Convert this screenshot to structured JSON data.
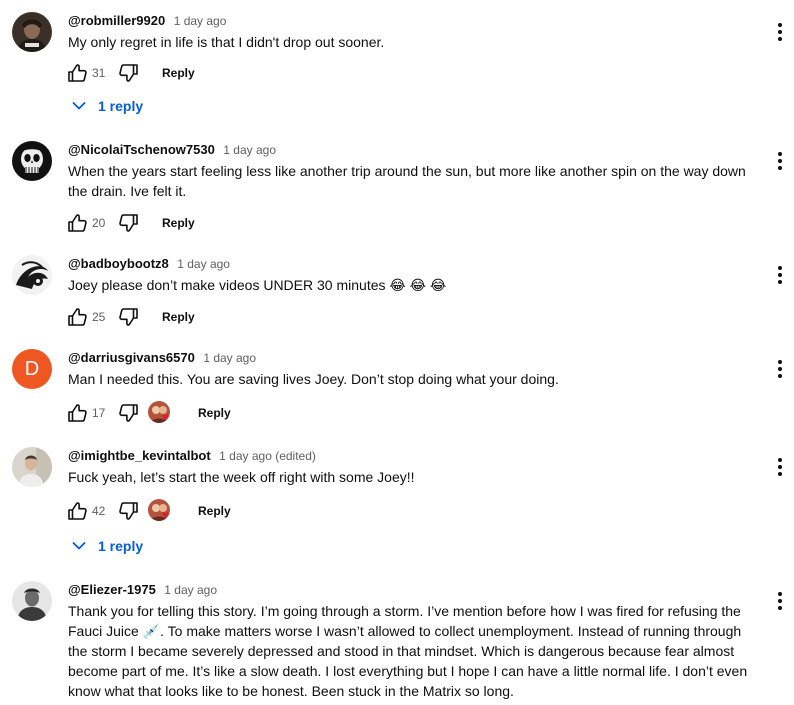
{
  "comments": [
    {
      "handle": "@robmiller9920",
      "time": "1 day ago",
      "text": "My only regret in life is that I didn't drop out sooner.",
      "likes": "31",
      "reply_label": "Reply",
      "replies_label": "1 reply",
      "avatar_icon": "photo-avatar-icon"
    },
    {
      "handle": "@NicolaiTschenow7530",
      "time": "1 day ago",
      "text": "When the years start feeling less like another trip around the sun, but more like another spin on the way down the drain. Ive felt it.",
      "likes": "20",
      "reply_label": "Reply",
      "avatar_icon": "skull-avatar-icon"
    },
    {
      "handle": "@badboybootz8",
      "time": "1 day ago",
      "text": "Joey please don’t make videos UNDER 30 minutes 😂 😂 😂",
      "likes": "25",
      "reply_label": "Reply",
      "avatar_icon": "bw-art-avatar-icon"
    },
    {
      "handle": "@darriusgivans6570",
      "time": "1 day ago",
      "text": "Man I needed this. You are saving lives Joey. Don’t stop doing what your doing.",
      "likes": "17",
      "reply_label": "Reply",
      "avatar_letter": "D",
      "avatar_color": "#ef5722",
      "creator_heart": true
    },
    {
      "handle": "@imightbe_kevintalbot",
      "time": "1 day ago (edited)",
      "text": "Fuck yeah, let’s start the week off right with some Joey!!",
      "likes": "42",
      "reply_label": "Reply",
      "replies_label": "1 reply",
      "avatar_icon": "person-photo-avatar-icon",
      "creator_heart": true
    },
    {
      "handle": "@Eliezer-1975",
      "time": "1 day ago",
      "text": "Thank you for telling this story. I’m going through a storm. I’ve mention before how I was fired for refusing the Fauci Juice 💉. To make matters worse I wasn’t allowed to collect unemployment. Instead of running through the storm I became severely depressed and stood in that mindset. Which is dangerous because fear almost become part of me. It’s like a slow death. I lost everything but I hope I can have a little normal life. I don’t even know what that looks like to be honest. Been stuck in the Matrix so long.",
      "avatar_icon": "person-photo-avatar-icon"
    }
  ],
  "colors": {
    "link_blue": "#065fd4",
    "meta_gray": "#606060",
    "heart_red": "#e01e2d",
    "letter_avatar": "#ef5722"
  }
}
